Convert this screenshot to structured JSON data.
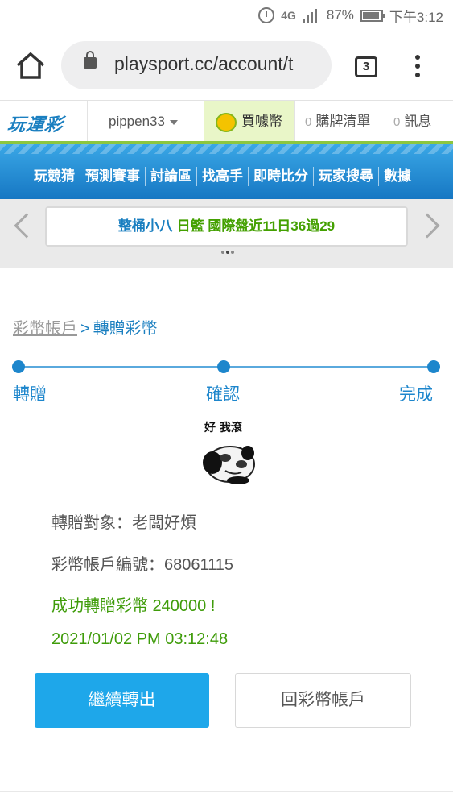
{
  "status_bar": {
    "network": "4G",
    "battery_percent": "87%",
    "time": "下午3:12",
    "icons": [
      "alarm-icon",
      "signal-icon",
      "battery-icon"
    ]
  },
  "browser": {
    "url": "playsport.cc/account/t",
    "tab_count": "3",
    "icons": [
      "home-icon",
      "lock-icon",
      "tabs-icon",
      "more-vert-icon"
    ]
  },
  "site_header": {
    "logo_text": "玩運彩",
    "username": "pippen33",
    "buy_coin_label": "買噱幣",
    "bought_count": "0",
    "bought_label": "購牌清單",
    "message_count": "0",
    "message_label": "訊息",
    "colors": {
      "brand_blue": "#1a7fc0",
      "accent_green": "#8cc63f"
    }
  },
  "nav": {
    "items": [
      "玩競猜",
      "預測賽事",
      "討論區",
      "找高手",
      "即時比分",
      "玩家搜尋",
      "數據"
    ]
  },
  "marquee": {
    "part1": "整桶小八",
    "part2": "日籃",
    "part3": "國際盤近11日36過29"
  },
  "breadcrumb": {
    "parent": "彩幣帳戶",
    "separator": ">",
    "current": "轉贈彩幣"
  },
  "steps": [
    {
      "label": "轉贈"
    },
    {
      "label": "確認"
    },
    {
      "label": "完成"
    }
  ],
  "sticker": {
    "caption": "好 我滾"
  },
  "details": {
    "recipient": "轉贈對象：老闆好煩",
    "account_no": "彩幣帳戶編號：68061115",
    "success": "成功轉贈彩幣 240000 !",
    "timestamp": "2021/01/02 PM 03:12:48"
  },
  "buttons": {
    "continue": "繼續轉出",
    "back": "回彩幣帳戶"
  }
}
